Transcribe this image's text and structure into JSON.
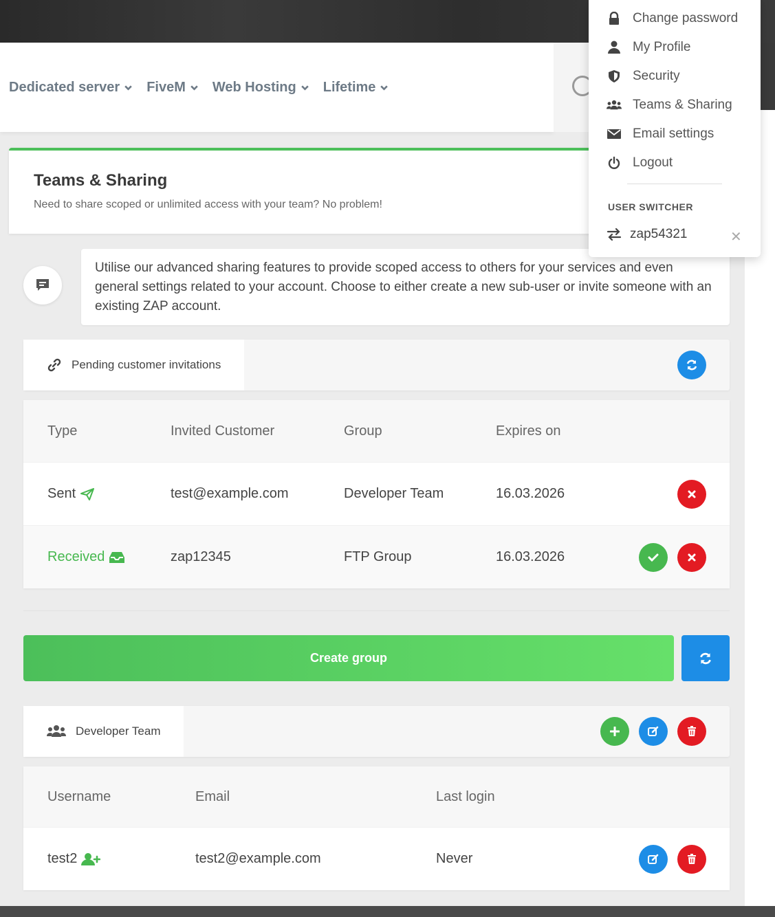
{
  "nav": {
    "items": [
      {
        "label": "Dedicated server"
      },
      {
        "label": "FiveM"
      },
      {
        "label": "Web Hosting"
      },
      {
        "label": "Lifetime"
      }
    ]
  },
  "header": {
    "title": "Teams & Sharing",
    "subtitle": "Need to share scoped or unlimited access with your team? No problem!"
  },
  "info": {
    "text": "Utilise our advanced sharing features to provide scoped access to others for your services and even general settings related to your account. Choose to either create a new sub-user or invite someone with an existing ZAP account."
  },
  "invitations": {
    "title": "Pending customer invitations",
    "columns": [
      "Type",
      "Invited Customer",
      "Group",
      "Expires on"
    ],
    "rows": [
      {
        "type": "Sent",
        "customer": "test@example.com",
        "group": "Developer Team",
        "expires": "16.03.2026"
      },
      {
        "type": "Received",
        "customer": "zap12345",
        "group": "FTP Group",
        "expires": "16.03.2026"
      }
    ]
  },
  "create_group_label": "Create group",
  "group": {
    "name": "Developer Team",
    "columns": [
      "Username",
      "Email",
      "Last login"
    ],
    "rows": [
      {
        "username": "test2",
        "email": "test2@example.com",
        "last_login": "Never"
      }
    ]
  },
  "menu": {
    "items": [
      {
        "label": "Change password",
        "icon": "lock-icon"
      },
      {
        "label": "My Profile",
        "icon": "user-icon"
      },
      {
        "label": "Security",
        "icon": "shield-icon"
      },
      {
        "label": "Teams & Sharing",
        "icon": "users-icon"
      },
      {
        "label": "Email settings",
        "icon": "envelope-icon"
      },
      {
        "label": "Logout",
        "icon": "power-icon"
      }
    ],
    "switcher_heading": "USER SWITCHER",
    "switcher_user": "zap54321"
  },
  "colors": {
    "accent_green": "#4cbf5a",
    "blue": "#1d8de6",
    "red": "#e31b23"
  }
}
